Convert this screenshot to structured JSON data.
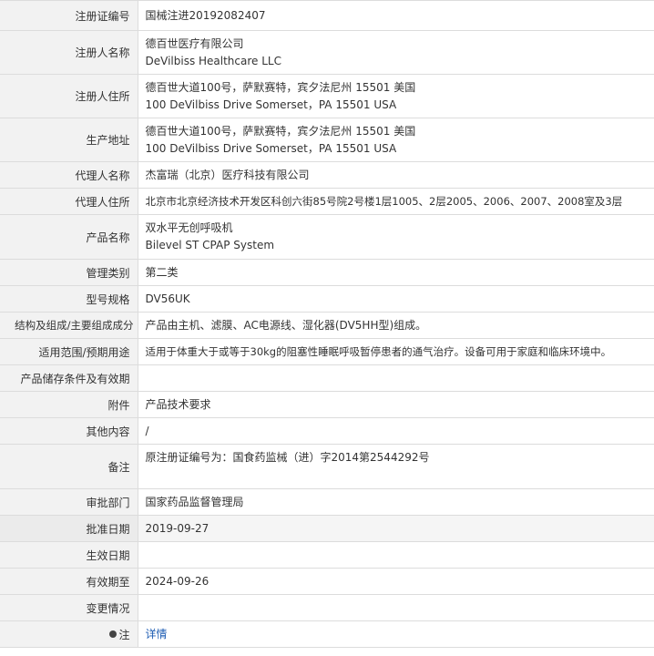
{
  "rows": [
    {
      "label": "注册证编号",
      "lines": [
        "国械注进20192082407"
      ]
    },
    {
      "label": "注册人名称",
      "lines": [
        "德百世医疗有限公司",
        "DeVilbiss Healthcare LLC"
      ]
    },
    {
      "label": "注册人住所",
      "lines": [
        "德百世大道100号，萨默赛特，宾夕法尼州 15501 美国",
        "100 DeVilbiss Drive Somerset，PA 15501 USA"
      ]
    },
    {
      "label": "生产地址",
      "lines": [
        "德百世大道100号，萨默赛特，宾夕法尼州 15501 美国",
        "100 DeVilbiss Drive Somerset，PA 15501 USA"
      ]
    },
    {
      "label": "代理人名称",
      "lines": [
        "杰富瑞（北京）医疗科技有限公司"
      ]
    },
    {
      "label": "代理人住所",
      "lines": [
        "北京市北京经济技术开发区科创六街85号院2号楼1层1005、2层2005、2006、2007、2008室及3层"
      ]
    },
    {
      "label": "产品名称",
      "lines": [
        "双水平无创呼吸机",
        "Bilevel ST CPAP System"
      ]
    },
    {
      "label": "管理类别",
      "lines": [
        "第二类"
      ]
    },
    {
      "label": "型号规格",
      "lines": [
        "DV56UK"
      ]
    },
    {
      "label": "结构及组成/主要组成成分",
      "lines": [
        "产品由主机、滤膜、AC电源线、湿化器(DV5HH型)组成。"
      ]
    },
    {
      "label": "适用范围/预期用途",
      "lines": [
        "适用于体重大于或等于30kg的阻塞性睡眠呼吸暂停患者的通气治疗。设备可用于家庭和临床环境中。"
      ]
    },
    {
      "label": "产品储存条件及有效期",
      "lines": []
    },
    {
      "label": "附件",
      "lines": [
        "产品技术要求"
      ]
    },
    {
      "label": "其他内容",
      "lines": [
        "/"
      ]
    },
    {
      "label": "备注",
      "lines": [
        "原注册证编号为：国食药监械（进）字2014第2544292号"
      ]
    },
    {
      "label": "审批部门",
      "lines": [
        "国家药品监督管理局"
      ]
    },
    {
      "label": "批准日期",
      "lines": [
        "2019-09-27"
      ]
    },
    {
      "label": "生效日期",
      "lines": []
    },
    {
      "label": "有效期至",
      "lines": [
        "2024-09-26"
      ]
    },
    {
      "label": "变更情况",
      "lines": []
    },
    {
      "label": "注",
      "lines": [
        "详情"
      ]
    }
  ]
}
